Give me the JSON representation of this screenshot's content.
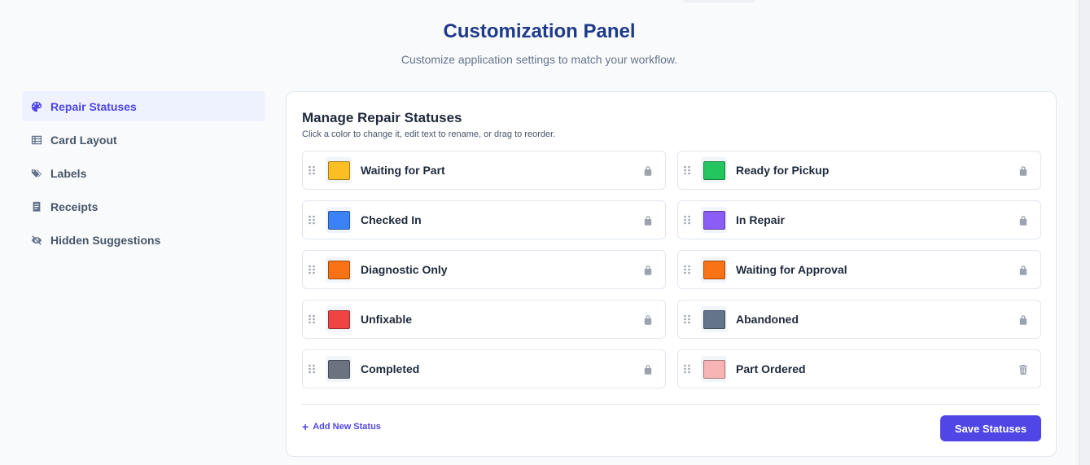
{
  "header": {
    "title": "Customization Panel",
    "subtitle": "Customize application settings to match your workflow."
  },
  "sidebar": {
    "items": [
      {
        "label": "Repair Statuses",
        "icon": "palette-icon",
        "active": true
      },
      {
        "label": "Card Layout",
        "icon": "table-icon",
        "active": false
      },
      {
        "label": "Labels",
        "icon": "tags-icon",
        "active": false
      },
      {
        "label": "Receipts",
        "icon": "receipt-icon",
        "active": false
      },
      {
        "label": "Hidden Suggestions",
        "icon": "eye-slash-icon",
        "active": false
      }
    ]
  },
  "panel": {
    "title": "Manage Repair Statuses",
    "hint": "Click a color to change it, edit text to rename, or drag to reorder.",
    "statuses": [
      {
        "name": "Waiting for Part",
        "color": "#fbbf24",
        "action": "lock-icon"
      },
      {
        "name": "Ready for Pickup",
        "color": "#22c55e",
        "action": "lock-icon"
      },
      {
        "name": "Checked In",
        "color": "#3b82f6",
        "action": "lock-icon"
      },
      {
        "name": "In Repair",
        "color": "#8b5cf6",
        "action": "lock-icon"
      },
      {
        "name": "Diagnostic Only",
        "color": "#f97316",
        "action": "lock-icon"
      },
      {
        "name": "Waiting for Approval",
        "color": "#f97316",
        "action": "lock-icon"
      },
      {
        "name": "Unfixable",
        "color": "#ef4444",
        "action": "lock-icon"
      },
      {
        "name": "Abandoned",
        "color": "#64748b",
        "action": "lock-icon"
      },
      {
        "name": "Completed",
        "color": "#6b7280",
        "action": "lock-icon"
      },
      {
        "name": "Part Ordered",
        "color": "#f8b4b4",
        "action": "trash-icon"
      }
    ],
    "add_label": "Add New Status",
    "save_label": "Save Statuses"
  },
  "colors": {
    "accent": "#4f46e5",
    "title": "#1e3a8a",
    "icon_muted": "#9ca3af"
  }
}
